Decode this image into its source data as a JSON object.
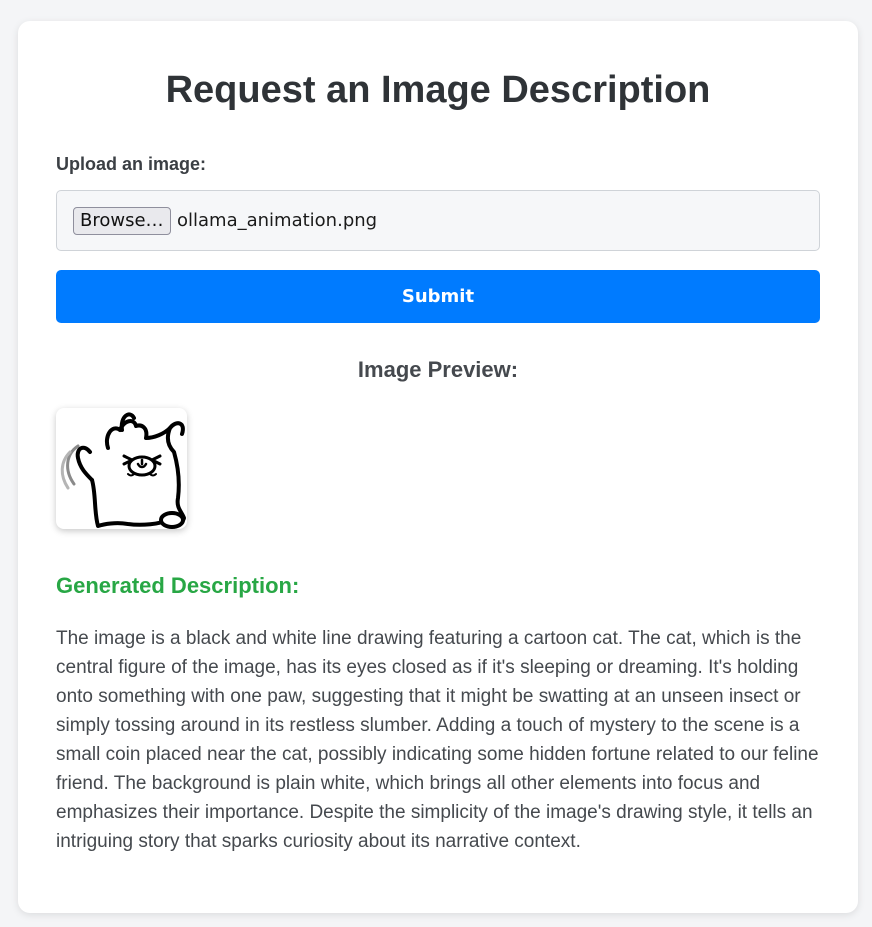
{
  "form": {
    "title": "Request an Image Description",
    "upload_label": "Upload an image:",
    "browse_label": "Browse…",
    "file_name": "ollama_animation.png",
    "submit_label": "Submit"
  },
  "preview": {
    "heading": "Image Preview:"
  },
  "description": {
    "heading": "Generated Description:",
    "text": "The image is a black and white line drawing featuring a cartoon cat. The cat, which is the central figure of the image, has its eyes closed as if it's sleeping or dreaming. It's holding onto something with one paw, suggesting that it might be swatting at an unseen insect or simply tossing around in its restless slumber. Adding a touch of mystery to the scene is a small coin placed near the cat, possibly indicating some hidden fortune related to our feline friend. The background is plain white, which brings all other elements into focus and emphasizes their importance. Despite the simplicity of the image's drawing style, it tells an intriguing story that sparks curiosity about its narrative context."
  },
  "colors": {
    "primary": "#007bff",
    "success": "#28a745",
    "text": "#45494e"
  }
}
